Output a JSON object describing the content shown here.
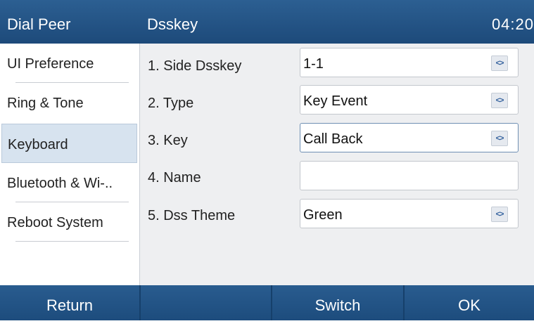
{
  "header": {
    "left_title": "Dial Peer",
    "mid_title": "Dsskey",
    "time": "04:20"
  },
  "sidebar": {
    "items": [
      {
        "label": "UI Preference"
      },
      {
        "label": "Ring & Tone"
      },
      {
        "label": "Keyboard",
        "active": true
      },
      {
        "label": "Bluetooth & Wi-.."
      },
      {
        "label": "Reboot System"
      }
    ]
  },
  "form": {
    "rows": [
      {
        "label": "1. Side Dsskey",
        "value": "1-1",
        "control": "spin-selector"
      },
      {
        "label": "2. Type",
        "value": "Key Event",
        "control": "spin-selector"
      },
      {
        "label": "3. Key",
        "value": "Call Back",
        "control": "spin-selector",
        "focused": true
      },
      {
        "label": "4. Name",
        "value": "",
        "control": "text-input"
      },
      {
        "label": "5. Dss Theme",
        "value": "Green",
        "control": "spin-selector"
      }
    ],
    "spin_icon": "<>"
  },
  "softkeys": [
    {
      "label": "Return"
    },
    {
      "label": ""
    },
    {
      "label": "Switch"
    },
    {
      "label": "OK"
    }
  ],
  "colors": {
    "header": "#1f4d7d",
    "softkey": "#245689",
    "active_item": "#d7e3ef",
    "content_bg": "#eeeff1"
  }
}
